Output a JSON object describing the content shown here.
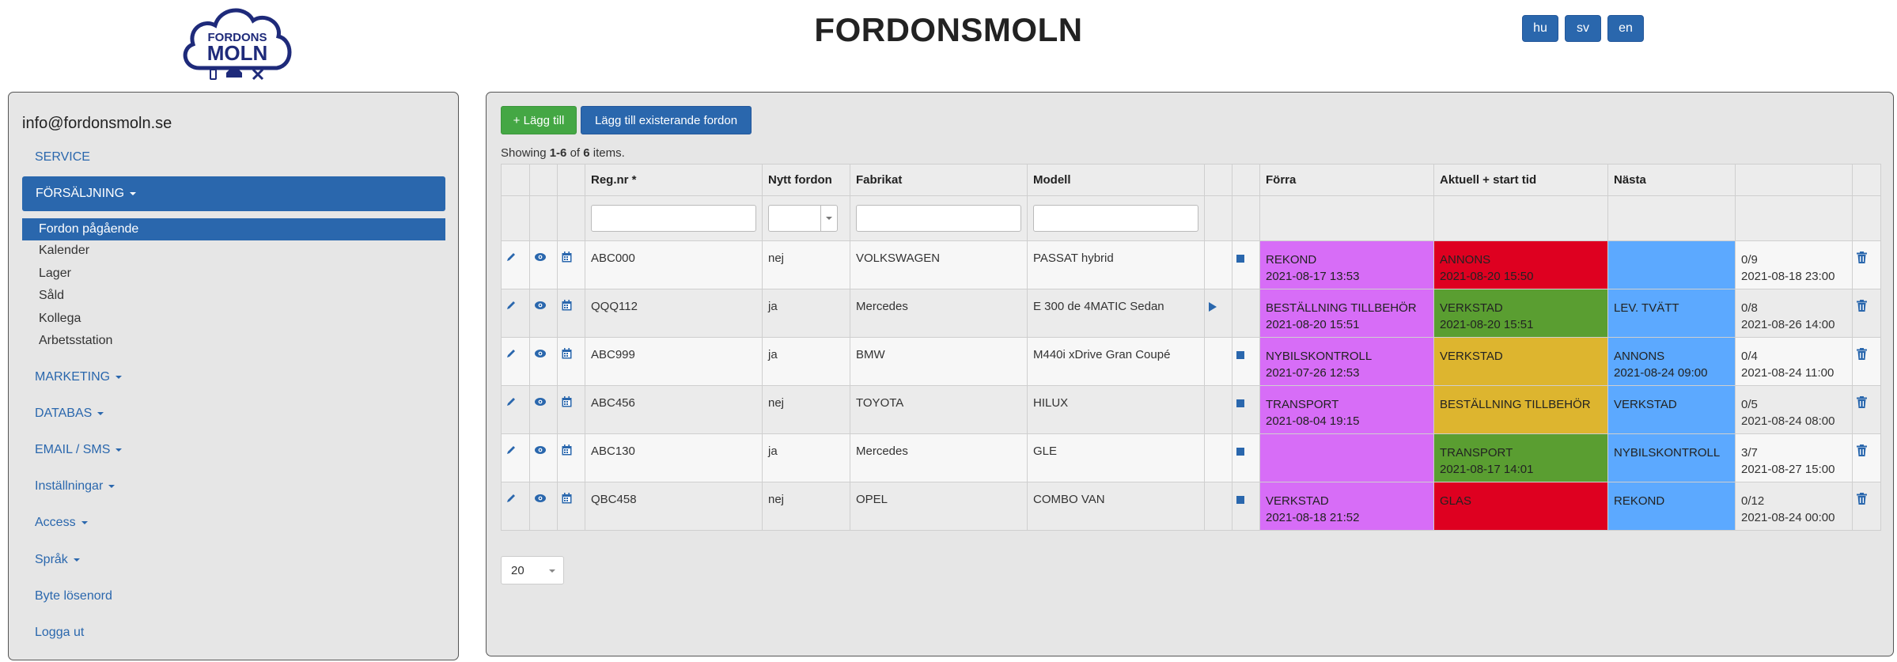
{
  "app": {
    "title": "FORDONSMOLN",
    "logo_top": "FORDONS",
    "logo_bottom": "MOLN",
    "languages": [
      "hu",
      "sv",
      "en"
    ]
  },
  "colors": {
    "primary": "#2a67ad",
    "success": "#44a744",
    "pink": "#d76df7",
    "red": "#de0020",
    "green": "#5a9e31",
    "yellow": "#ddb52f",
    "blue": "#5ca9ff"
  },
  "sidebar": {
    "email": "info@fordonsmoln.se",
    "service": "SERVICE",
    "forsaljning": "FÖRSÄLJNING",
    "sub_items": [
      "Fordon pågående",
      "Kalender",
      "Lager",
      "Såld",
      "Kollega",
      "Arbetsstation"
    ],
    "menus": [
      "MARKETING",
      "DATABAS",
      "EMAIL / SMS",
      "Inställningar",
      "Access",
      "Språk"
    ],
    "change_password": "Byte lösenord",
    "logout": "Logga ut"
  },
  "toolbar": {
    "add_label": "+ Lägg till",
    "add_existing_label": "Lägg till existerande fordon"
  },
  "summary": {
    "prefix": "Showing ",
    "range": "1-6",
    "mid": " of ",
    "total": "6",
    "suffix": " items."
  },
  "table": {
    "columns": {
      "reg": "Reg.nr *",
      "nytt": "Nytt fordon",
      "fabrikat": "Fabrikat",
      "modell": "Modell",
      "forra": "Förra",
      "aktuell": "Aktuell + start tid",
      "nasta": "Nästa"
    },
    "rows": [
      {
        "reg": "ABC000",
        "nytt": "nej",
        "fabrikat": "VOLKSWAGEN",
        "modell": "PASSAT hybrid",
        "flag": "square",
        "forra": "REKOND",
        "forra_time": "2021-08-17 13:53",
        "forra_color": "pink",
        "aktuell": "ANNONS",
        "aktuell_time": "2021-08-20 15:50",
        "aktuell_color": "red",
        "nasta": "",
        "nasta_time": "",
        "nasta_color": "blue",
        "count": "0/9",
        "deadline": "2021-08-18 23:00"
      },
      {
        "reg": "QQQ112",
        "nytt": "ja",
        "fabrikat": "Mercedes",
        "modell": "E 300 de 4MATIC Sedan",
        "flag": "play",
        "forra": "BESTÄLLNING TILLBEHÖR",
        "forra_time": "2021-08-20 15:51",
        "forra_color": "pink",
        "aktuell": "VERKSTAD",
        "aktuell_time": "2021-08-20 15:51",
        "aktuell_color": "green",
        "nasta": "LEV. TVÄTT",
        "nasta_time": "",
        "nasta_color": "blue",
        "count": "0/8",
        "deadline": "2021-08-26 14:00"
      },
      {
        "reg": "ABC999",
        "nytt": "ja",
        "fabrikat": "BMW",
        "modell": "M440i xDrive Gran Coupé",
        "flag": "square",
        "forra": "NYBILSKONTROLL",
        "forra_time": "2021-07-26 12:53",
        "forra_color": "pink",
        "aktuell": "VERKSTAD",
        "aktuell_time": "",
        "aktuell_color": "yellow",
        "nasta": "ANNONS",
        "nasta_time": "2021-08-24 09:00",
        "nasta_color": "blue",
        "count": "0/4",
        "deadline": "2021-08-24 11:00"
      },
      {
        "reg": "ABC456",
        "nytt": "nej",
        "fabrikat": "TOYOTA",
        "modell": "HILUX",
        "flag": "square",
        "forra": "TRANSPORT",
        "forra_time": "2021-08-04 19:15",
        "forra_color": "pink",
        "aktuell": "BESTÄLLNING TILLBEHÖR",
        "aktuell_time": "",
        "aktuell_color": "yellow",
        "nasta": "VERKSTAD",
        "nasta_time": "",
        "nasta_color": "blue",
        "count": "0/5",
        "deadline": "2021-08-24 08:00"
      },
      {
        "reg": "ABC130",
        "nytt": "ja",
        "fabrikat": "Mercedes",
        "modell": "GLE",
        "flag": "square",
        "forra": "",
        "forra_time": "",
        "forra_color": "pink",
        "aktuell": "TRANSPORT",
        "aktuell_time": "2021-08-17 14:01",
        "aktuell_color": "green",
        "nasta": "NYBILSKONTROLL",
        "nasta_time": "",
        "nasta_color": "blue",
        "count": "3/7",
        "deadline": "2021-08-27 15:00"
      },
      {
        "reg": "QBC458",
        "nytt": "nej",
        "fabrikat": "OPEL",
        "modell": "COMBO VAN",
        "flag": "square",
        "forra": "VERKSTAD",
        "forra_time": "2021-08-18 21:52",
        "forra_color": "pink",
        "aktuell": "GLAS",
        "aktuell_time": "",
        "aktuell_color": "red",
        "nasta": "REKOND",
        "nasta_time": "",
        "nasta_color": "blue",
        "count": "0/12",
        "deadline": "2021-08-24 00:00"
      }
    ]
  },
  "pager": {
    "page_size": "20"
  }
}
